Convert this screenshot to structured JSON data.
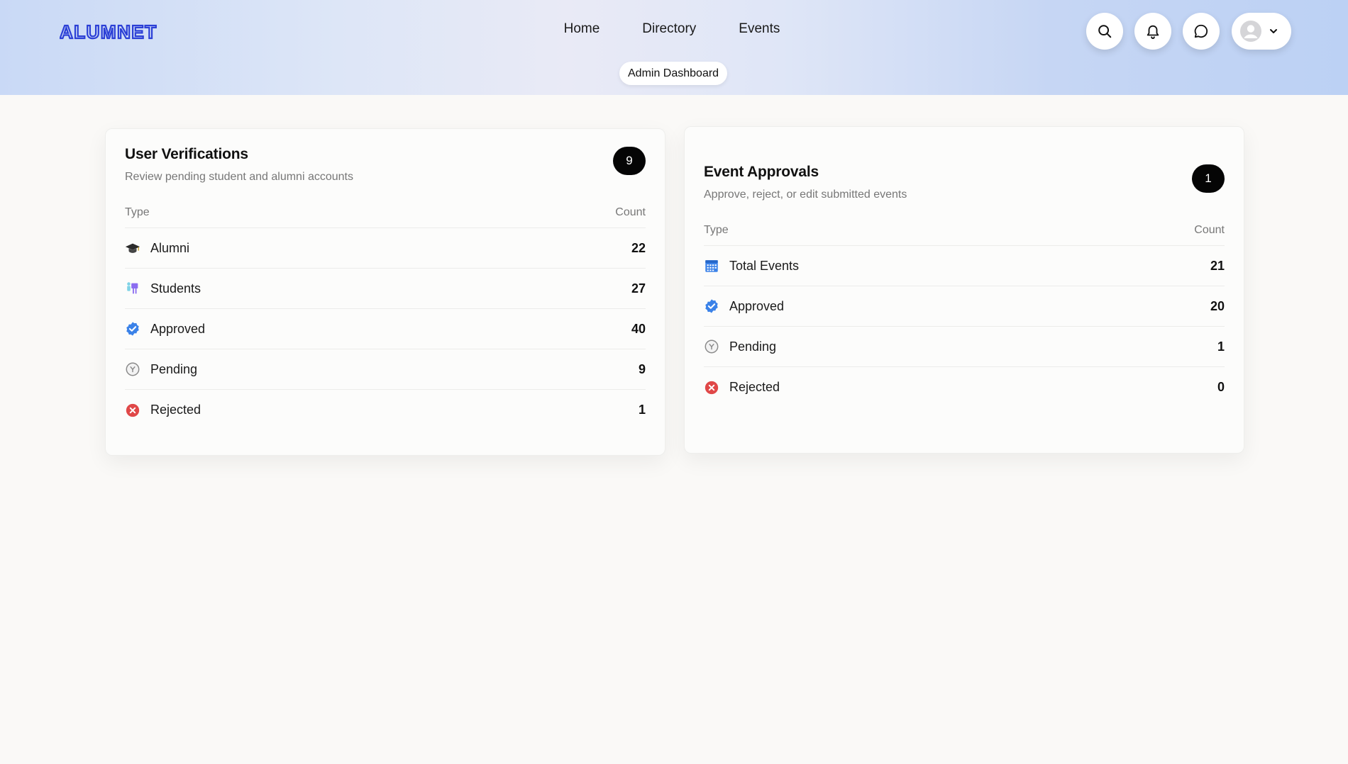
{
  "brand": {
    "logo_text": "ALUMNET",
    "accent_color": "#2b3fd6"
  },
  "nav": {
    "items": [
      {
        "label": "Home"
      },
      {
        "label": "Directory"
      },
      {
        "label": "Events"
      }
    ],
    "admin_label": "Admin Dashboard"
  },
  "header_actions": {
    "search_icon": "search-icon",
    "notifications_icon": "bell-icon",
    "messages_icon": "chat-icon",
    "profile_icon": "avatar-icon",
    "dropdown_icon": "chevron-down-icon"
  },
  "user_verifications": {
    "title": "User Verifications",
    "subtitle": "Review pending student and alumni accounts",
    "badge": "9",
    "col_type": "Type",
    "col_count": "Count",
    "rows": [
      {
        "icon": "graduation-cap-icon",
        "label": "Alumni",
        "count": "22"
      },
      {
        "icon": "students-icon",
        "label": "Students",
        "count": "27"
      },
      {
        "icon": "verified-check-icon",
        "label": "Approved",
        "count": "40"
      },
      {
        "icon": "pending-clock-icon",
        "label": "Pending",
        "count": "9"
      },
      {
        "icon": "rejected-x-icon",
        "label": "Rejected",
        "count": "1"
      }
    ]
  },
  "event_approvals": {
    "title": "Event Approvals",
    "subtitle": "Approve, reject, or edit submitted events",
    "badge": "1",
    "col_type": "Type",
    "col_count": "Count",
    "rows": [
      {
        "icon": "calendar-icon",
        "label": "Total Events",
        "count": "21"
      },
      {
        "icon": "verified-check-icon",
        "label": "Approved",
        "count": "20"
      },
      {
        "icon": "pending-clock-icon",
        "label": "Pending",
        "count": "1"
      },
      {
        "icon": "rejected-x-icon",
        "label": "Rejected",
        "count": "0"
      }
    ]
  }
}
